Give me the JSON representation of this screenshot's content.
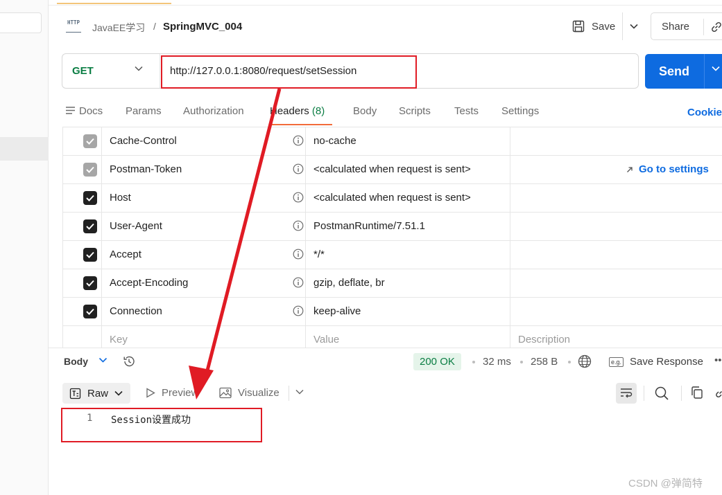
{
  "breadcrumb": {
    "parent": "JavaEE学习",
    "separator": "/",
    "current": "SpringMVC_004",
    "icon": "http-icon"
  },
  "toolbar": {
    "save_label": "Save",
    "share_label": "Share"
  },
  "request": {
    "method": "GET",
    "url": "http://127.0.0.1:8080/request/setSession",
    "send_label": "Send"
  },
  "request_tabs": [
    {
      "label": "Docs"
    },
    {
      "label": "Params"
    },
    {
      "label": "Authorization"
    },
    {
      "label": "Headers",
      "count": "(8)",
      "active": true
    },
    {
      "label": "Body"
    },
    {
      "label": "Scripts"
    },
    {
      "label": "Tests"
    },
    {
      "label": "Settings"
    }
  ],
  "cookies_label": "Cookie",
  "headers": [
    {
      "key": "Cache-Control",
      "value": "no-cache",
      "checked": true,
      "disabled": true
    },
    {
      "key": "Postman-Token",
      "value": "<calculated when request is sent>",
      "checked": true,
      "disabled": true,
      "action": "Go to settings"
    },
    {
      "key": "Host",
      "value": "<calculated when request is sent>",
      "checked": true,
      "disabled": false
    },
    {
      "key": "User-Agent",
      "value": "PostmanRuntime/7.51.1",
      "checked": true,
      "disabled": false
    },
    {
      "key": "Accept",
      "value": "*/*",
      "checked": true,
      "disabled": false
    },
    {
      "key": "Accept-Encoding",
      "value": "gzip, deflate, br",
      "checked": true,
      "disabled": false
    },
    {
      "key": "Connection",
      "value": "keep-alive",
      "checked": true,
      "disabled": false
    }
  ],
  "headers_placeholder": {
    "key": "Key",
    "value": "Value",
    "description": "Description"
  },
  "response": {
    "body_label": "Body",
    "status": "200 OK",
    "time": "32 ms",
    "size": "258 B",
    "save_response_label": "Save Response",
    "save_response_badge": "e.g.",
    "views": {
      "raw": "Raw",
      "preview": "Preview",
      "visualize": "Visualize"
    },
    "lines": [
      {
        "no": "1",
        "text": "Session设置成功"
      }
    ]
  },
  "annotation_color": "#e01b24",
  "watermark": "CSDN @弹简特"
}
